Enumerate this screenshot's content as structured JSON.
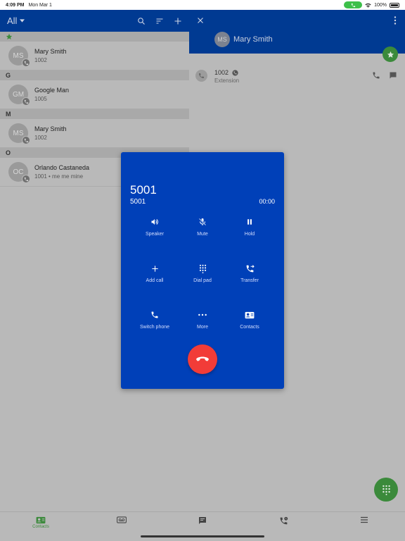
{
  "status_bar": {
    "time": "4:09 PM",
    "date": "Mon Mar 1",
    "battery": "100%"
  },
  "left_pane": {
    "filter_label": "All",
    "sections": [
      {
        "header": "",
        "contacts": [
          {
            "initials": "MS",
            "name": "Mary Smith",
            "sub": "1002"
          }
        ]
      },
      {
        "header": "G",
        "contacts": [
          {
            "initials": "GM",
            "name": "Google Man",
            "sub": "1005"
          }
        ]
      },
      {
        "header": "M",
        "contacts": [
          {
            "initials": "MS",
            "name": "Mary Smith",
            "sub": "1002"
          }
        ]
      },
      {
        "header": "O",
        "contacts": [
          {
            "initials": "OC",
            "name": "Orlando Castaneda",
            "sub": "1001 • me me mine"
          }
        ]
      }
    ]
  },
  "right_pane": {
    "initials": "MS",
    "name": "Mary Smith",
    "extension_number": "1002",
    "extension_label": "Extension"
  },
  "call_dialog": {
    "number": "5001",
    "subtitle": "5001",
    "timer": "00:00",
    "controls": [
      "Speaker",
      "Mute",
      "Hold",
      "Add call",
      "Dial pad",
      "Transfer",
      "Switch phone",
      "More",
      "Contacts"
    ]
  },
  "bottom_nav": {
    "contacts_label": "Contacts"
  },
  "colors": {
    "header_blue": "#003a92",
    "dialog_blue": "#0040b8",
    "accent_green": "#3b8a3b",
    "hangup_red": "#f23c38"
  }
}
